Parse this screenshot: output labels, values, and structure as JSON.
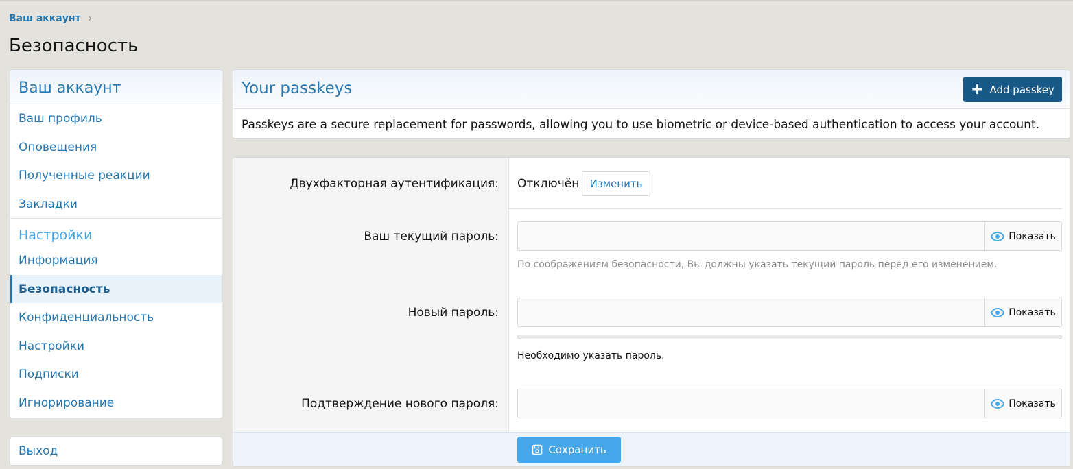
{
  "breadcrumb": {
    "label": "Ваш аккаунт"
  },
  "page": {
    "title": "Безопасность"
  },
  "sidebar": {
    "header": "Ваш аккаунт",
    "items_account": [
      {
        "label": "Ваш профиль"
      },
      {
        "label": "Оповещения"
      },
      {
        "label": "Полученные реакции"
      },
      {
        "label": "Закладки"
      }
    ],
    "group_settings": "Настройки",
    "items_settings": [
      {
        "label": "Информация"
      },
      {
        "label": "Безопасность",
        "active": true
      },
      {
        "label": "Конфиденциальность"
      },
      {
        "label": "Настройки"
      },
      {
        "label": "Подписки"
      },
      {
        "label": "Игнорирование"
      }
    ],
    "logout": "Выход"
  },
  "passkeys": {
    "title": "Your passkeys",
    "add_label": "Add passkey",
    "description": "Passkeys are a secure replacement for passwords, allowing you to use biometric or device-based authentication to access your account."
  },
  "form": {
    "tfa_label": "Двухфакторная аутентификация:",
    "tfa_status": "Отключён",
    "tfa_change": "Изменить",
    "current_password_label": "Ваш текущий пароль:",
    "current_password_value": "",
    "current_password_hint": "По соображениям безопасности, Вы должны указать текущий пароль перед его изменением.",
    "new_password_label": "Новый пароль:",
    "new_password_value": "",
    "new_password_strength": 0,
    "new_password_required": "Необходимо указать пароль.",
    "confirm_password_label": "Подтверждение нового пароля:",
    "confirm_password_value": "",
    "show_label": "Показать",
    "save_label": "Сохранить"
  },
  "colors": {
    "link": "#2577b1",
    "accent_light": "#47a7eb",
    "primary_button": "#185886",
    "page_bg": "#e4e2dd"
  }
}
